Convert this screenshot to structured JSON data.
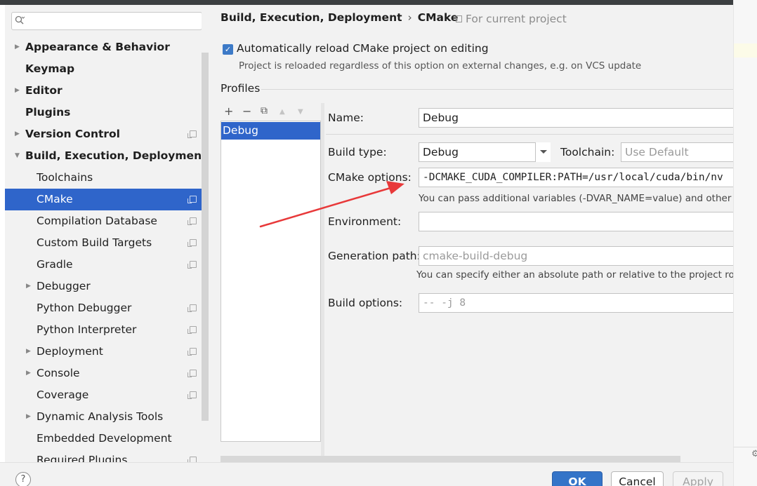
{
  "search": {
    "placeholder": ""
  },
  "sidebar": {
    "items": [
      {
        "label": "Appearance & Behavior"
      },
      {
        "label": "Keymap"
      },
      {
        "label": "Editor"
      },
      {
        "label": "Plugins"
      },
      {
        "label": "Version Control"
      },
      {
        "label": "Build, Execution, Deployment"
      },
      {
        "label": "Toolchains"
      },
      {
        "label": "CMake"
      },
      {
        "label": "Compilation Database"
      },
      {
        "label": "Custom Build Targets"
      },
      {
        "label": "Gradle"
      },
      {
        "label": "Debugger"
      },
      {
        "label": "Python Debugger"
      },
      {
        "label": "Python Interpreter"
      },
      {
        "label": "Deployment"
      },
      {
        "label": "Console"
      },
      {
        "label": "Coverage"
      },
      {
        "label": "Dynamic Analysis Tools"
      },
      {
        "label": "Embedded Development"
      },
      {
        "label": "Required Plugins"
      }
    ]
  },
  "breadcrumb": {
    "parent": "Build, Execution, Deployment",
    "separator": "›",
    "current": "CMake",
    "scope": "For current project"
  },
  "auto_reload": {
    "checked": true,
    "check_glyph": "✓",
    "label": "Automatically reload CMake project on editing",
    "hint": "Project is reloaded regardless of this option on external changes, e.g. on VCS update"
  },
  "profiles": {
    "title": "Profiles",
    "toolbar": {
      "add": "+",
      "remove": "−",
      "copy": "⧉",
      "up": "▲",
      "down": "▼"
    },
    "items": [
      "Debug"
    ]
  },
  "form": {
    "name_label": "Name:",
    "name_value": "Debug",
    "build_type_label": "Build type:",
    "build_type_value": "Debug",
    "toolchain_label": "Toolchain:",
    "toolchain_placeholder": "Use Default",
    "cmake_options_label": "CMake options:",
    "cmake_options_value": "-DCMAKE_CUDA_COMPILER:PATH=/usr/local/cuda/bin/nv",
    "cmake_options_hint": "You can pass additional variables (-DVAR_NAME=value) and other options",
    "environment_label": "Environment:",
    "environment_value": "",
    "generation_path_label": "Generation path:",
    "generation_path_placeholder": "cmake-build-debug",
    "generation_path_hint": "You can specify either an absolute path or relative to the project root",
    "build_options_label": "Build options:",
    "build_options_placeholder": "-- -j 8"
  },
  "footer": {
    "help": "?",
    "ok": "OK",
    "cancel": "Cancel",
    "apply": "Apply"
  },
  "colors": {
    "selection": "#2f65ca",
    "primary_button": "#3474c8",
    "annotation_arrow": "#e8393a"
  },
  "right_strip": {
    "gear": "⚙"
  }
}
